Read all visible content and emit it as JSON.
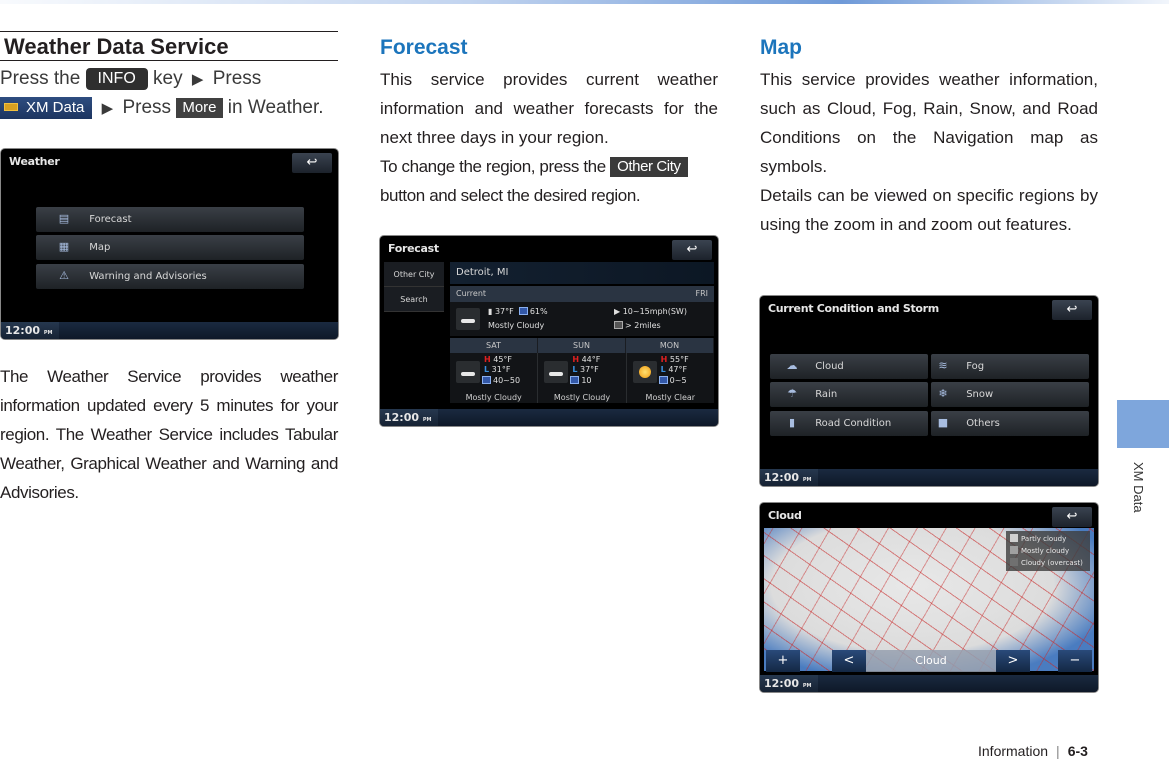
{
  "sidebar_tab": {
    "label": "XM Data",
    "color": "#7ea6dc"
  },
  "footer": {
    "section": "Information",
    "separator": "|",
    "page": "6-3"
  },
  "col1": {
    "title": "Weather Data Service",
    "instruction": {
      "press_the": "Press the",
      "info_key": "INFO",
      "key_word": "key",
      "arrow": "▶",
      "press": "Press",
      "xm_data_button": "XM Data",
      "press2": "Press",
      "more_button": "More",
      "in_weather": "in Weather."
    },
    "screen": {
      "title": "Weather",
      "back_icon": "↩",
      "menu": [
        {
          "icon": "forecast-icon",
          "glyph": "▤",
          "label": "Forecast"
        },
        {
          "icon": "map-icon",
          "glyph": "▦",
          "label": "Map"
        },
        {
          "icon": "warning-icon",
          "glyph": "⚠",
          "label": "Warning and Advisories"
        }
      ],
      "clock": "12:00",
      "ampm": "PM"
    },
    "body": "The Weather Service provides weather information updated every 5 minutes for your region. The Weather Service includes Tabular Weather, Graphical Weather and Warning and Advisories."
  },
  "col2": {
    "title": "Forecast",
    "body1": "This service  provides current weather information and weather forecasts for the next three days in your region.",
    "body2_pre": "To change the region, press the",
    "other_city_button": "Other City",
    "body2_post": "button and select the desired region.",
    "screen": {
      "title": "Forecast",
      "back_icon": "↩",
      "side_buttons": [
        "Other City",
        "Search"
      ],
      "city": "Detroit, MI",
      "current_label": "Current",
      "current_day": "FRI",
      "current": {
        "temp": "37°F",
        "humidity": "61%",
        "condition": "Mostly Cloudy",
        "wind": "10~15mph(SW)",
        "visibility": "> 2miles"
      },
      "days": [
        {
          "name": "SAT",
          "icon": "cloud",
          "high": "45°F",
          "low": "31°F",
          "extra": "40~50",
          "condition": "Mostly Cloudy"
        },
        {
          "name": "SUN",
          "icon": "cloud",
          "high": "44°F",
          "low": "37°F",
          "extra": "10",
          "condition": "Mostly Cloudy"
        },
        {
          "name": "MON",
          "icon": "sun",
          "high": "55°F",
          "low": "47°F",
          "extra": "0~5",
          "condition": "Mostly Clear"
        }
      ],
      "high_prefix": "H",
      "low_prefix": "L",
      "clock": "12:00",
      "ampm": "PM"
    }
  },
  "col3": {
    "title": "Map",
    "body1": "This service provides weather information, such as Cloud, Fog, Rain, Snow, and Road Conditions on the Navigation map as symbols.",
    "body2": "Details can be viewed on specific regions by using the zoom in and zoom out features.",
    "screen1": {
      "title": "Current Condition and Storm",
      "back_icon": "↩",
      "items": [
        {
          "icon": "cloud-icon",
          "glyph": "☁",
          "label": "Cloud"
        },
        {
          "icon": "fog-icon",
          "glyph": "≋",
          "label": "Fog"
        },
        {
          "icon": "rain-icon",
          "glyph": "☂",
          "label": "Rain"
        },
        {
          "icon": "snow-icon",
          "glyph": "❄",
          "label": "Snow"
        },
        {
          "icon": "road-icon",
          "glyph": "▮",
          "label": "Road Condition"
        },
        {
          "icon": "others-icon",
          "glyph": "■",
          "label": "Others"
        }
      ],
      "clock": "12:00",
      "ampm": "PM"
    },
    "screen2": {
      "title": "Cloud",
      "back_icon": "↩",
      "legend": [
        {
          "label": "Partly cloudy",
          "color": "#d0d0d0"
        },
        {
          "label": "Mostly cloudy",
          "color": "#a0a0a0"
        },
        {
          "label": "Cloudy (overcast)",
          "color": "#707070"
        }
      ],
      "zoom_in": "+",
      "prev": "<",
      "layer": "Cloud",
      "next": ">",
      "zoom_out": "−",
      "clock": "12:00",
      "ampm": "PM"
    }
  }
}
